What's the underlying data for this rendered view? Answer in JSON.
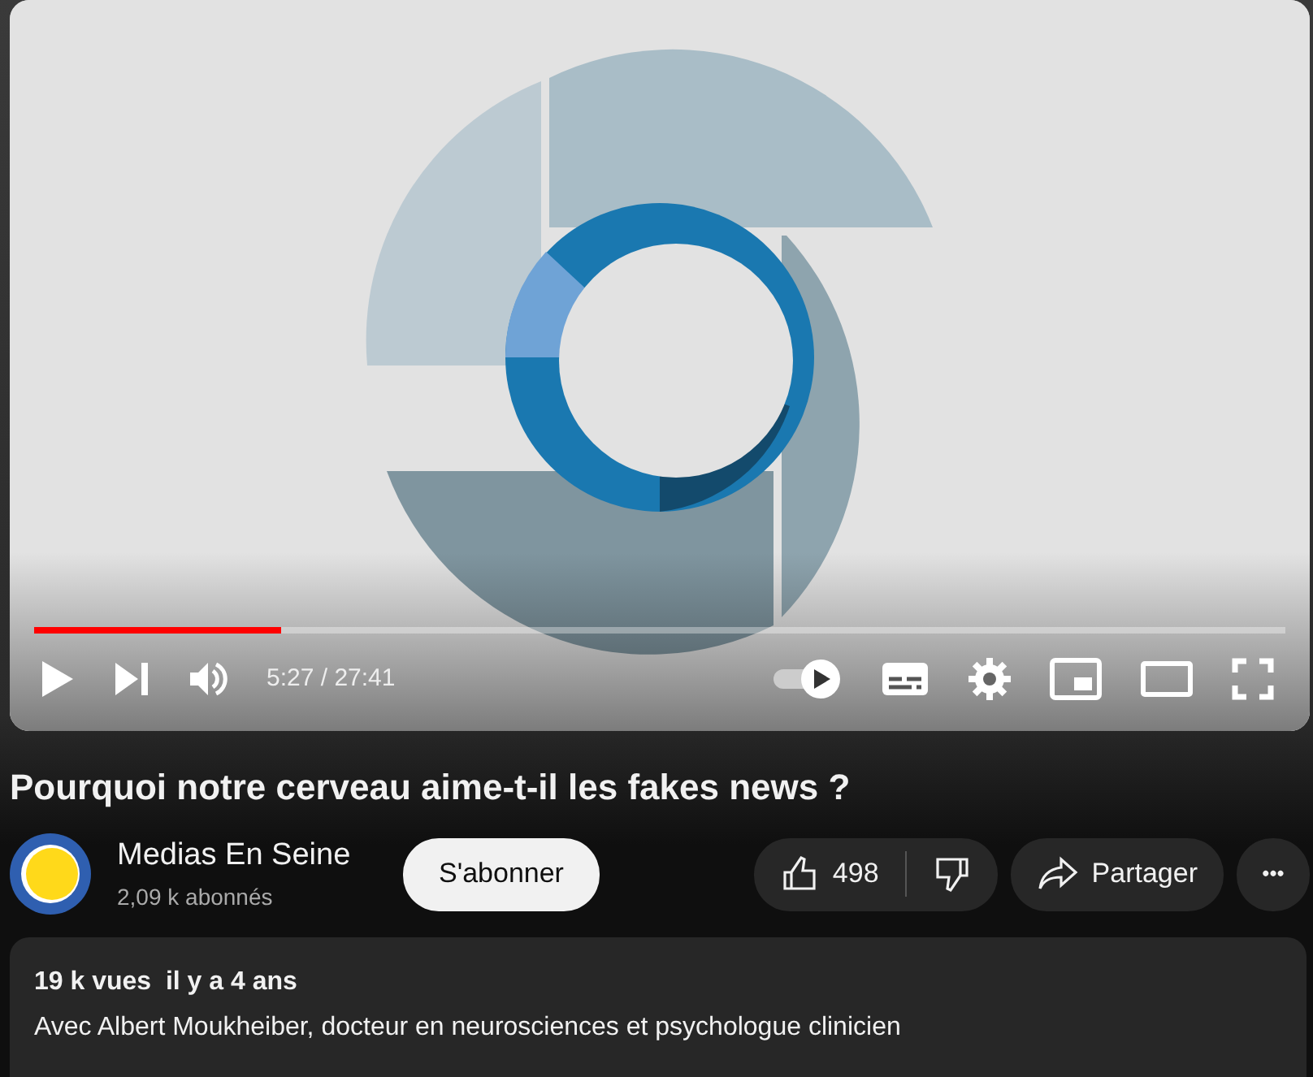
{
  "player": {
    "progress": {
      "level": 0.197
    },
    "time": "5:27 / 27:41",
    "autoplay": {
      "on": true
    }
  },
  "title": "Pourquoi notre cerveau aime-t-il les fakes news ?",
  "channel": {
    "name": "Medias En Seine",
    "subscribers": "2,09 k abonnés"
  },
  "subscribe_button": "S'abonner",
  "likes": "498",
  "share_button": "Partager",
  "more_button": "•••",
  "description": {
    "stats": "19 k vues  il y a 4 ans",
    "text": "Avec Albert Moukheiber, docteur en neurosciences et psychologue clinicien"
  }
}
